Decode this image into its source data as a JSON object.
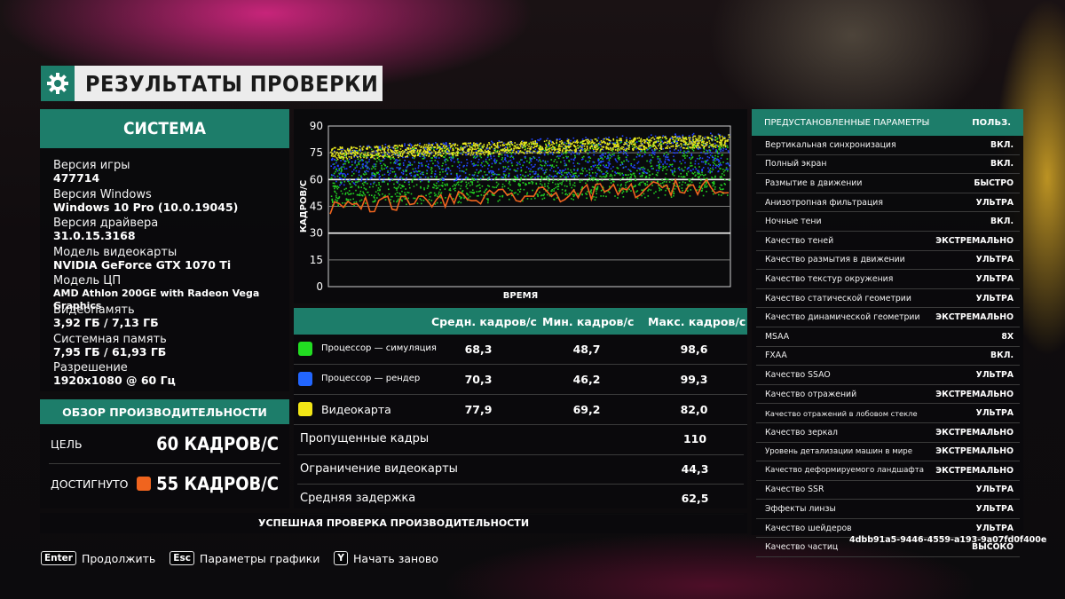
{
  "header": {
    "title": "РЕЗУЛЬТАТЫ ПРОВЕРКИ",
    "icon": "gear-icon"
  },
  "system": {
    "title": "СИСТЕМА",
    "items": [
      {
        "label": "Версия игры",
        "value": "477714"
      },
      {
        "label": "Версия Windows",
        "value": "Windows 10 Pro (10.0.19045)"
      },
      {
        "label": "Версия драйвера",
        "value": "31.0.15.3168"
      },
      {
        "label": "Модель видеокарты",
        "value": "NVIDIA GeForce GTX 1070 Ti"
      },
      {
        "label": "Модель ЦП",
        "value": "AMD Athlon 200GE with Radeon Vega Graphics"
      },
      {
        "label": "Видеопамять",
        "value": "3,92 ГБ / 7,13 ГБ"
      },
      {
        "label": "Системная память",
        "value": "7,95 ГБ / 61,93 ГБ"
      },
      {
        "label": "Разрешение",
        "value": "1920x1080 @ 60 Гц"
      }
    ]
  },
  "overview": {
    "title": "ОБЗОР ПРОИЗВОДИТЕЛЬНОСТИ",
    "target_label": "ЦЕЛЬ",
    "target_value": "60 КАДРОВ/С",
    "achieved_label": "ДОСТИГНУТО",
    "achieved_value": "55 КАДРОВ/С",
    "achieved_color": "#f0641e"
  },
  "chart": {
    "ylabel": "КАДРОВ/С",
    "xlabel": "ВРЕМЯ",
    "y_ticks": [
      "90",
      "75",
      "60",
      "45",
      "30",
      "15",
      "0"
    ],
    "ylim": [
      0,
      90
    ],
    "series_colors": {
      "cpu_sim": "#22cc22",
      "cpu_render": "#2244ff",
      "gpu": "#e6e61e",
      "frame": "#f0641e"
    }
  },
  "stats": {
    "headers": {
      "avg": "Средн. кадров/с",
      "min": "Мин. кадров/с",
      "max": "Макс. кадров/с"
    },
    "rows": [
      {
        "name": "Процессор — симуляция",
        "color": "#22dd22",
        "avg": "68,3",
        "min": "48,7",
        "max": "98,6"
      },
      {
        "name": "Процессор — рендер",
        "color": "#2266ff",
        "avg": "70,3",
        "min": "46,2",
        "max": "99,3"
      },
      {
        "name": "Видеокарта",
        "color": "#f2e616",
        "avg": "77,9",
        "min": "69,2",
        "max": "82,0"
      }
    ],
    "metrics": [
      {
        "name": "Пропущенные кадры",
        "value": "110"
      },
      {
        "name": "Ограничение видеокарты",
        "value": "44,3"
      },
      {
        "name": "Средняя задержка",
        "value": "62,5"
      }
    ]
  },
  "success": "УСПЕШНАЯ ПРОВЕРКА ПРОИЗВОДИТЕЛЬНОСТИ",
  "presets": {
    "title": "ПРЕДУСТАНОВЛЕННЫЕ ПАРАМЕТРЫ",
    "value": "ПОЛЬЗ.",
    "items": [
      {
        "name": "Вертикальная синхронизация",
        "value": "ВКЛ."
      },
      {
        "name": "Полный экран",
        "value": "ВКЛ."
      },
      {
        "name": "Размытие в движении",
        "value": "БЫСТРО"
      },
      {
        "name": "Анизотропная фильтрация",
        "value": "УЛЬТРА"
      },
      {
        "name": "Ночные тени",
        "value": "ВКЛ."
      },
      {
        "name": "Качество теней",
        "value": "ЭКСТРЕМАЛЬНО"
      },
      {
        "name": "Качество размытия в движении",
        "value": "УЛЬТРА"
      },
      {
        "name": "Качество текстур окружения",
        "value": "УЛЬТРА"
      },
      {
        "name": "Качество статической геометрии",
        "value": "УЛЬТРА"
      },
      {
        "name": "Качество динамической геометрии",
        "value": "ЭКСТРЕМАЛЬНО"
      },
      {
        "name": "MSAA",
        "value": "8X"
      },
      {
        "name": "FXAA",
        "value": "ВКЛ."
      },
      {
        "name": "Качество SSAO",
        "value": "УЛЬТРА"
      },
      {
        "name": "Качество отражений",
        "value": "ЭКСТРЕМАЛЬНО"
      },
      {
        "name": "Качество отражений в лобовом стекле",
        "value": "УЛЬТРА"
      },
      {
        "name": "Качество зеркал",
        "value": "ЭКСТРЕМАЛЬНО"
      },
      {
        "name": "Уровень детализации машин в мире",
        "value": "ЭКСТРЕМАЛЬНО"
      },
      {
        "name": "Качество деформируемого ландшафта",
        "value": "ЭКСТРЕМАЛЬНО"
      },
      {
        "name": "Качество SSR",
        "value": "УЛЬТРА"
      },
      {
        "name": "Эффекты линзы",
        "value": "УЛЬТРА"
      },
      {
        "name": "Качество шейдеров",
        "value": "УЛЬТРА"
      },
      {
        "name": "Качество частиц",
        "value": "ВЫСОКО"
      }
    ]
  },
  "guid": "4dbb91a5-9446-4559-a193-9a07fd0f400e",
  "footer": [
    {
      "key": "Enter",
      "label": "Продолжить"
    },
    {
      "key": "Esc",
      "label": "Параметры графики"
    },
    {
      "key": "Y",
      "label": "Начать заново"
    }
  ]
}
